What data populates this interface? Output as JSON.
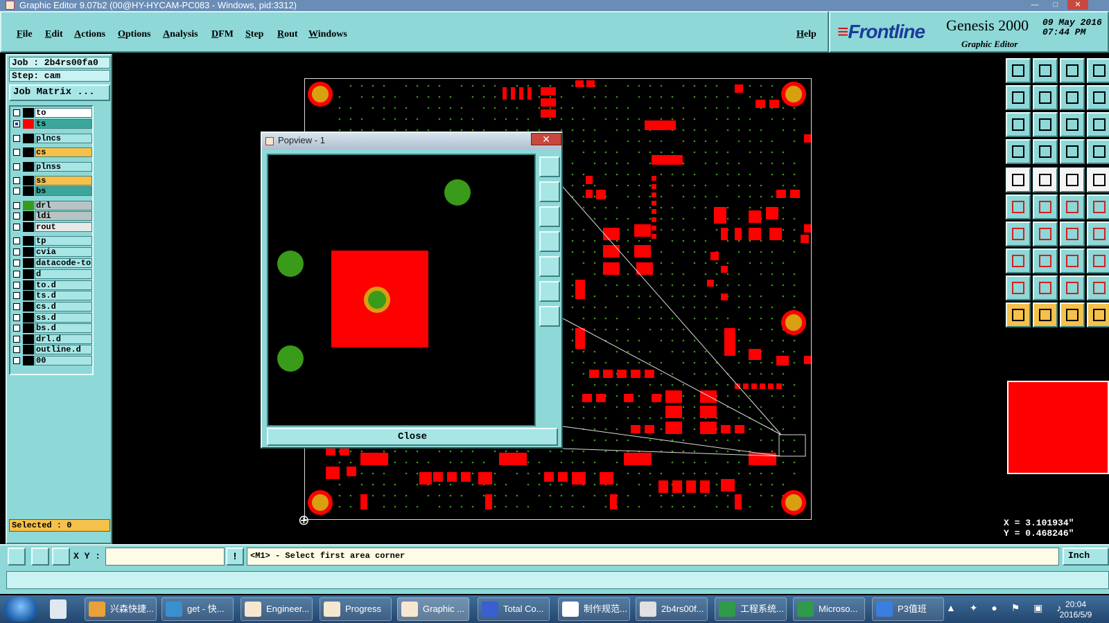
{
  "window": {
    "title": "Graphic Editor 9.07b2 (00@HY-HYCAM-PC083 - Windows, pid:3312)",
    "minimize": "—",
    "maximize": "□",
    "close": "✕"
  },
  "menu": {
    "items": [
      "File",
      "Edit",
      "Actions",
      "Options",
      "Analysis",
      "DFM",
      "Step",
      "Rout",
      "Windows"
    ],
    "help": "Help"
  },
  "logo": {
    "brand": "Frontline",
    "product": "Genesis 2000",
    "subtitle": "Graphic Editor",
    "date": "09 May 2016",
    "time": "07:44 PM"
  },
  "left_panel": {
    "job": "Job : 2b4rs00fa0",
    "step": "Step: cam",
    "job_matrix": "Job Matrix ...",
    "layers": [
      {
        "name": "to",
        "bg": "#ffffff",
        "swatch": "#000000",
        "checked": false
      },
      {
        "name": "ts",
        "bg": "#3aa79a",
        "swatch": "#ff0000",
        "checked": true
      },
      {
        "name": "plncs",
        "bg": "#a8e6e6",
        "swatch": "#000000",
        "checked": false
      },
      {
        "name": "cs",
        "bg": "#f5c14a",
        "swatch": "#000000",
        "checked": false
      },
      {
        "name": "plnss",
        "bg": "#a8e6e6",
        "swatch": "#000000",
        "checked": false
      },
      {
        "name": "ss",
        "bg": "#f5c14a",
        "swatch": "#000000",
        "checked": false
      },
      {
        "name": "bs",
        "bg": "#3aa79a",
        "swatch": "#000000",
        "checked": false
      },
      {
        "name": "drl",
        "bg": "#b8c4c4",
        "swatch": "#3a9a1a",
        "checked": false
      },
      {
        "name": "ldi",
        "bg": "#b8c4c4",
        "swatch": "#000000",
        "checked": false
      },
      {
        "name": "rout",
        "bg": "#e8e8e8",
        "swatch": "#000000",
        "checked": false
      },
      {
        "name": "tp",
        "bg": "#a8e6e6",
        "swatch": "#000000",
        "checked": false
      },
      {
        "name": "cvia",
        "bg": "#a8e6e6",
        "swatch": "#000000",
        "checked": false
      },
      {
        "name": "datacode-to",
        "bg": "#a8e6e6",
        "swatch": "#000000",
        "checked": false
      },
      {
        "name": "d",
        "bg": "#a8e6e6",
        "swatch": "#000000",
        "checked": false
      },
      {
        "name": "to.d",
        "bg": "#a8e6e6",
        "swatch": "#000000",
        "checked": false
      },
      {
        "name": "ts.d",
        "bg": "#a8e6e6",
        "swatch": "#000000",
        "checked": false
      },
      {
        "name": "cs.d",
        "bg": "#a8e6e6",
        "swatch": "#000000",
        "checked": false
      },
      {
        "name": "ss.d",
        "bg": "#a8e6e6",
        "swatch": "#000000",
        "checked": false
      },
      {
        "name": "bs.d",
        "bg": "#a8e6e6",
        "swatch": "#000000",
        "checked": false
      },
      {
        "name": "drl.d",
        "bg": "#a8e6e6",
        "swatch": "#000000",
        "checked": false
      },
      {
        "name": "outline.d",
        "bg": "#a8e6e6",
        "swatch": "#000000",
        "checked": false
      },
      {
        "name": "00",
        "bg": "#a8e6e6",
        "swatch": "#000000",
        "checked": false
      }
    ],
    "selected": "Selected : 0"
  },
  "popview": {
    "title": "Popview - 1",
    "close_x": "✕",
    "close_button": "Close"
  },
  "coords": {
    "x": "X = 3.101934\"",
    "y": "Y = 0.468246\""
  },
  "command_bar": {
    "xy_label": "X Y :",
    "xy_value": "",
    "alert": "!",
    "message": "<M1> - Select first area corner",
    "units": "Inch"
  },
  "taskbar": {
    "tasks": [
      {
        "label": "兴森快捷...",
        "color": "#e9a13b"
      },
      {
        "label": "get - 快...",
        "color": "#3a8fcf"
      },
      {
        "label": "Engineer...",
        "color": "#f6e7d0"
      },
      {
        "label": "Progress",
        "color": "#f6e7d0"
      },
      {
        "label": "Graphic ...",
        "color": "#f6e7d0"
      },
      {
        "label": "Total Co...",
        "color": "#3a5fcf"
      },
      {
        "label": "制作规范...",
        "color": "#ffffff"
      },
      {
        "label": "2b4rs00f...",
        "color": "#e0e0e0"
      },
      {
        "label": "工程系统...",
        "color": "#2e9a4a"
      },
      {
        "label": "Microso...",
        "color": "#2e9a4a"
      },
      {
        "label": "P3值班",
        "color": "#3a7fdf"
      }
    ],
    "time": "20:04",
    "date": "2016/5/9"
  },
  "colors": {
    "panel": "#8ed8d8",
    "copper": "#ff0000",
    "drill": "#3a9a1a",
    "selected": "#f5c14a"
  }
}
